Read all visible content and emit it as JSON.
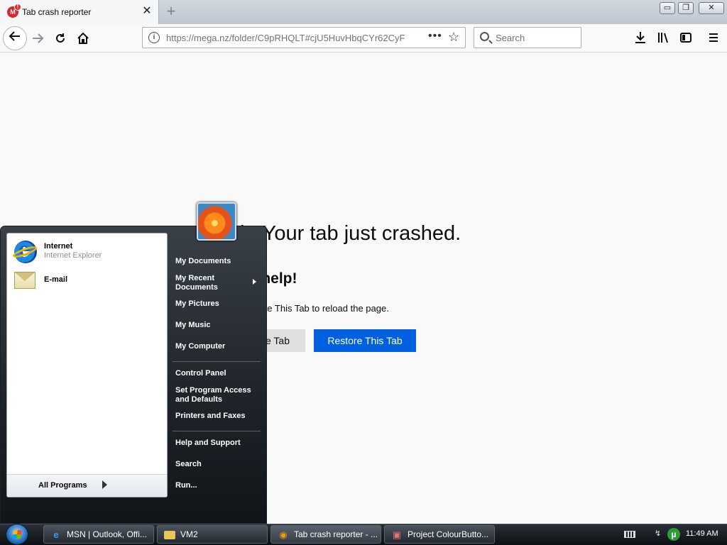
{
  "browser": {
    "tab_title": "Tab crash reporter",
    "tab_close": "✕",
    "new_tab": "+",
    "url": "https://mega.nz/folder/C9pRHQLT#cjU5HuvHbqCYr62CyF",
    "url_info": "i",
    "page_actions": "•••",
    "bookmark_star": "☆",
    "search_placeholder": "Search",
    "icons": {
      "back": "arrow-left-icon",
      "forward": "arrow-right-icon",
      "reload": "reload-icon",
      "home": "home-icon",
      "downloads": "download-icon",
      "library": "library-icon",
      "sidebar": "sidebar-icon",
      "menu": "hamburger-menu-icon"
    },
    "window_controls": {
      "minimize": "▭",
      "restore": "❐",
      "close": "✕"
    }
  },
  "crash_page": {
    "title_fragment": "h. Your tab just crashed.",
    "help_fragment": "an help!",
    "description_fragment": "Restore This Tab to reload the page.",
    "close_tab_fragment": "e Tab",
    "restore_button": "Restore This Tab"
  },
  "start_menu": {
    "pinned": [
      {
        "title": "Internet",
        "subtitle": "Internet Explorer",
        "icon": "internet-explorer-icon"
      },
      {
        "title": "E-mail",
        "subtitle": "",
        "icon": "email-envelope-icon"
      }
    ],
    "all_programs": "All Programs",
    "right_items": {
      "my_documents": "My Documents",
      "my_recent_documents": "My Recent Documents",
      "my_pictures": "My Pictures",
      "my_music": "My Music",
      "my_computer": "My Computer",
      "control_panel": "Control Panel",
      "set_program_access": "Set Program Access and Defaults",
      "printers_and_faxes": "Printers and Faxes",
      "help_and_support": "Help and Support",
      "search": "Search",
      "run": "Run..."
    }
  },
  "taskbar": {
    "buttons": [
      {
        "label": "MSN | Outlook, Offi...",
        "icon": "ie-icon"
      },
      {
        "label": "VM2",
        "icon": "folder-icon"
      },
      {
        "label": "Tab crash reporter - ...",
        "icon": "firefox-icon"
      },
      {
        "label": "Project ColourButto...",
        "icon": "app-icon"
      }
    ],
    "clock": "11:49 AM",
    "utorrent": "µ"
  },
  "colors": {
    "restore_button": "#0060df",
    "start_menu_dark": "#20252b",
    "taskbar": "#1a1f25"
  }
}
